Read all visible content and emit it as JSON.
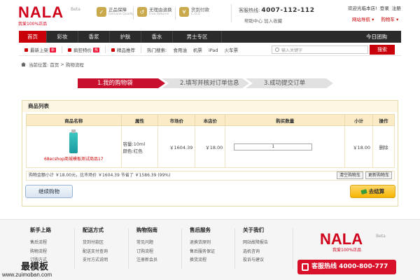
{
  "header": {
    "logo_text": "NALA",
    "logo_beta": "Beta",
    "slogan": "我爱100%正品",
    "promises": [
      {
        "title": "正品保障",
        "en": "Genuine Quality",
        "icon": "shield-icon"
      },
      {
        "title": "无理由退换",
        "en": "Free Returns",
        "icon": "return-icon"
      },
      {
        "title": "货到付款",
        "en": "C.O.D",
        "icon": "cash-icon"
      }
    ],
    "hotline_label": "客服热线:",
    "hotline_number": "4007-112-112",
    "help_links": "帮助中心 加入收藏",
    "welcome": "欢迎光临本店!",
    "login": "登录",
    "register": "注册",
    "site_nav": "网站导航 ▾",
    "cart": "购物车 ▾"
  },
  "nav": {
    "items": [
      "首页",
      "彩妆",
      "香浆",
      "护肤",
      "香水",
      "男士专区"
    ],
    "right": "今日团购"
  },
  "subnav": {
    "items": [
      "最新上架",
      "疯狂特价",
      "精品推荐"
    ],
    "badges": [
      "新",
      "热"
    ],
    "hot_label": "热门搜索:",
    "hot_terms": [
      "食用油",
      "机票",
      "iPad",
      "火车票"
    ],
    "search_placeholder": "输入关键字",
    "search_button": "搜索"
  },
  "breadcrumb": {
    "label": "当前位置:",
    "home": "首页",
    "sep": ">",
    "current": "购物流程"
  },
  "steps": [
    "1.我的购物袋",
    "2.填写并核对订单信息",
    "3.成功提交订单"
  ],
  "cart": {
    "title": "商品列表",
    "columns": [
      "商品名称",
      "属性",
      "市场价",
      "本店价",
      "购买数量",
      "小计",
      "操作"
    ],
    "rows": [
      {
        "name": "68ecshop商城模板测试商品17",
        "attr_capacity": "容量:10ml",
        "attr_color": "颜色:红色",
        "market_price": "￥1604.39",
        "shop_price": "￥18.00",
        "quantity": "1",
        "subtotal": "￥18.00",
        "action": "删除"
      }
    ],
    "summary": "购物金额小计 ￥18.00元，比市场价 ￥1604.39 节省了 ￥1586.39 (99%)",
    "clear_button": "清空购物车",
    "update_button": "更新购物车",
    "continue_button": "继续购物",
    "checkout_button": "去结算"
  },
  "footer": {
    "columns": [
      {
        "title": "新手上路",
        "links": [
          "售后流程",
          "购物流程",
          "订购方式"
        ]
      },
      {
        "title": "配送方式",
        "links": [
          "货到付款区",
          "配送支付查询",
          "支付方式说明"
        ]
      },
      {
        "title": "购物指南",
        "links": [
          "常见问题",
          "订购流程",
          "注册新会员"
        ]
      },
      {
        "title": "售后服务",
        "links": [
          "退换货原则",
          "售后服务保证",
          "换货流程"
        ]
      },
      {
        "title": "关于我们",
        "links": [
          "网站故障报告",
          "选机咨询",
          "投诉与建议"
        ]
      }
    ],
    "logo_text": "NALA",
    "logo_beta": "Beta",
    "slogan": "我爱100%正品",
    "watermark": "最模板",
    "watermark_url": "www.zuimoban.com",
    "cs_label": "客服热线",
    "cs_number": "4000-800-777"
  }
}
